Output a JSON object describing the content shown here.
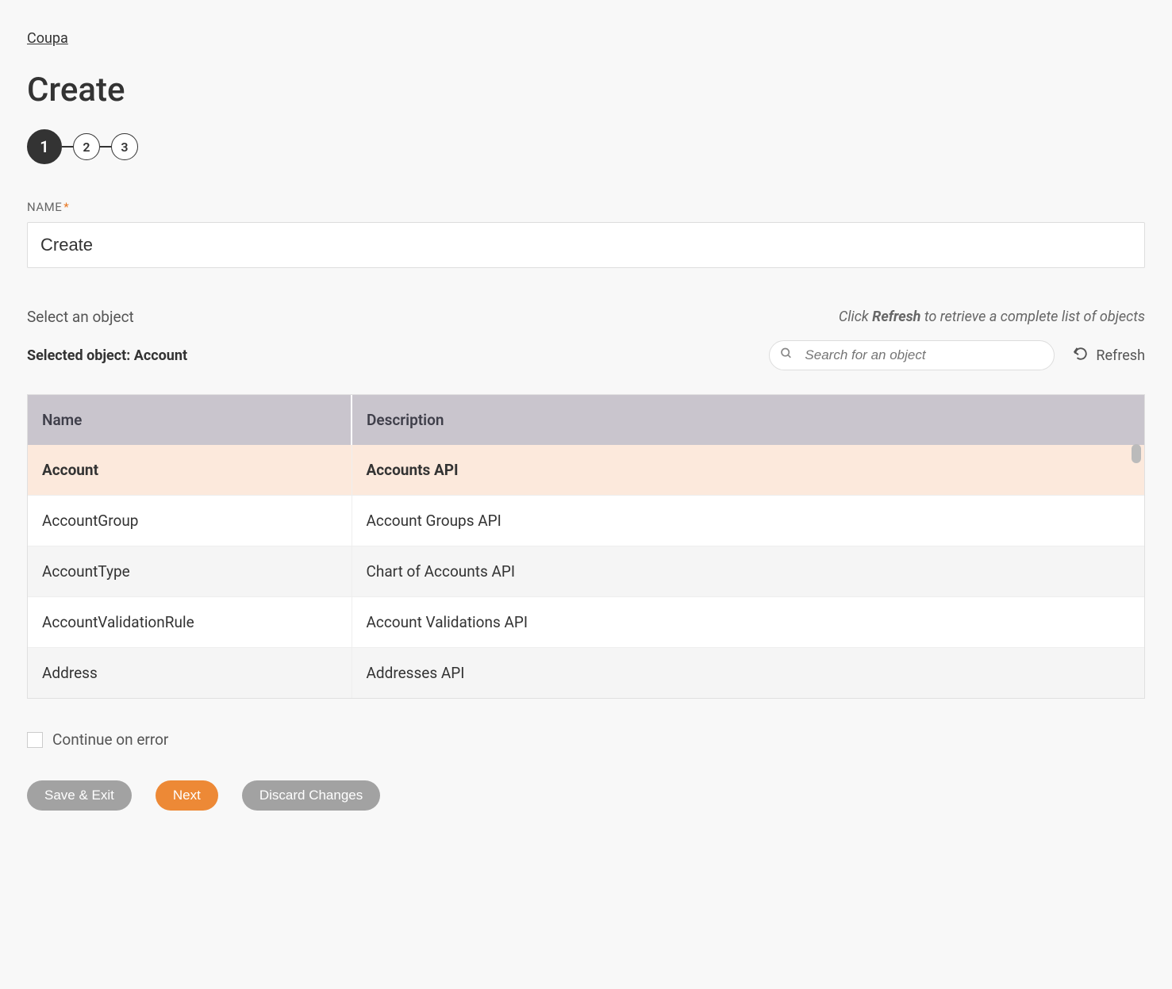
{
  "breadcrumb": "Coupa",
  "page_title": "Create",
  "stepper": {
    "steps": [
      "1",
      "2",
      "3"
    ],
    "active_index": 0
  },
  "name_field": {
    "label": "NAME",
    "value": "Create"
  },
  "select_section": {
    "label": "Select an object",
    "hint_prefix": "Click ",
    "hint_bold": "Refresh",
    "hint_suffix": " to retrieve a complete list of objects",
    "selected_label": "Selected object: ",
    "selected_value": "Account",
    "search_placeholder": "Search for an object",
    "refresh_label": "Refresh"
  },
  "table": {
    "columns": [
      "Name",
      "Description"
    ],
    "rows": [
      {
        "name": "Account",
        "description": "Accounts API",
        "selected": true
      },
      {
        "name": "AccountGroup",
        "description": "Account Groups API",
        "selected": false
      },
      {
        "name": "AccountType",
        "description": "Chart of Accounts API",
        "selected": false
      },
      {
        "name": "AccountValidationRule",
        "description": "Account Validations API",
        "selected": false
      },
      {
        "name": "Address",
        "description": "Addresses API",
        "selected": false
      }
    ]
  },
  "continue_on_error_label": "Continue on error",
  "buttons": {
    "save_exit": "Save & Exit",
    "next": "Next",
    "discard": "Discard Changes"
  }
}
